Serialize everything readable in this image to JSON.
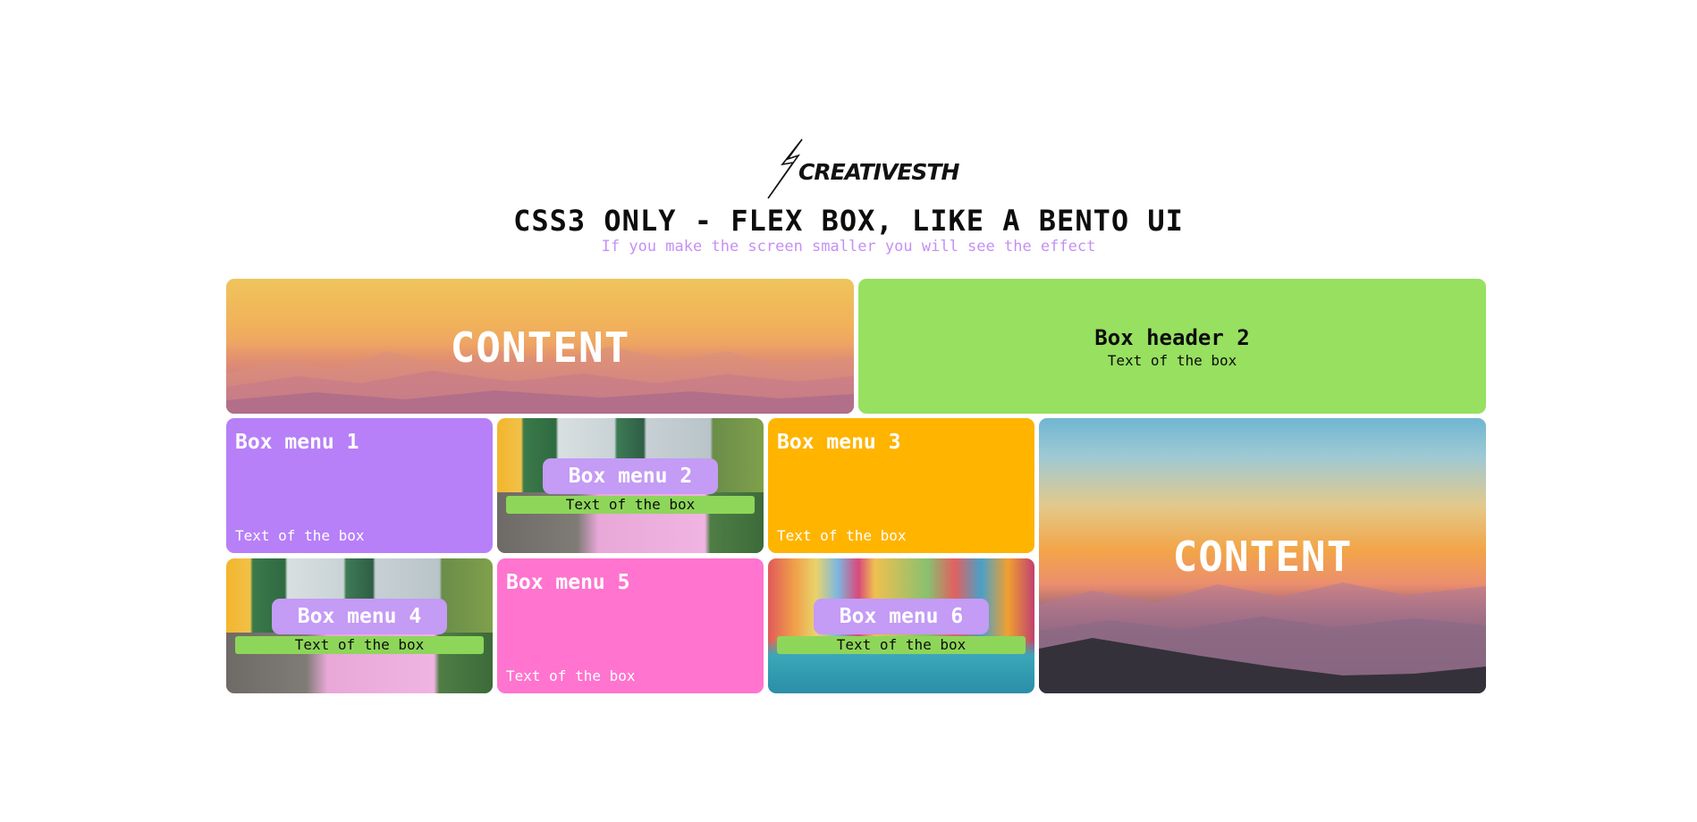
{
  "brand": {
    "logo_text": "CREATIVESTH",
    "logo_icon": "lightning-bolt-icon"
  },
  "title": "CSS3 ONLY - FLEX BOX, LIKE A BENTO UI",
  "subtitle": "If you make the screen smaller you will see the effect",
  "boxes": {
    "header1": {
      "label": "CONTENT"
    },
    "header2": {
      "title": "Box header 2",
      "text": "Text of the box"
    },
    "menu1": {
      "title": "Box menu 1",
      "text": "Text of the box"
    },
    "menu2": {
      "title": "Box menu 2",
      "text": "Text of the box"
    },
    "menu3": {
      "title": "Box menu 3",
      "text": "Text of the box"
    },
    "menu4": {
      "title": "Box menu 4",
      "text": "Text of the box"
    },
    "menu5": {
      "title": "Box menu 5",
      "text": "Text of the box"
    },
    "menu6": {
      "title": "Box menu 6",
      "text": "Text of the box"
    },
    "side": {
      "label": "CONTENT"
    }
  },
  "colors": {
    "green": "#97e060",
    "purple": "#b780f8",
    "orange": "#ffb400",
    "pink": "#ff74cf",
    "subtitle": "#c590f3"
  }
}
